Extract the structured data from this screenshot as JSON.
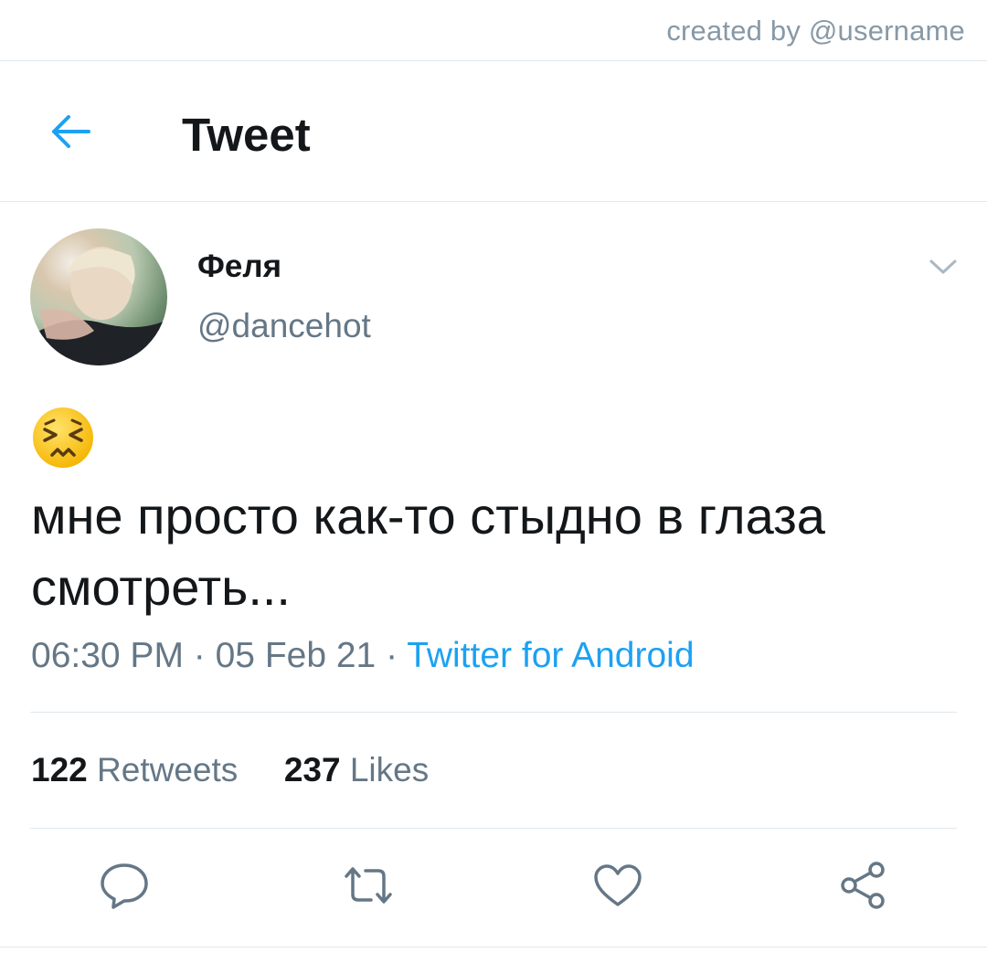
{
  "credit": "created by @username",
  "header": {
    "title": "Tweet"
  },
  "author": {
    "name": "Феля",
    "handle": "@dancehot"
  },
  "tweet": {
    "emoji": "😣",
    "text": "мне просто как-то стыдно в глаза смотреть..."
  },
  "meta": {
    "time": "06:30 PM",
    "separator": " · ",
    "date": "05 Feb 21",
    "source": "Twitter for Android"
  },
  "stats": {
    "retweets_count": "122",
    "retweets_label": "Retweets",
    "likes_count": "237",
    "likes_label": "Likes"
  },
  "icons": {
    "back": "back-arrow-icon",
    "more": "chevron-down-icon",
    "reply": "reply-icon",
    "retweet": "retweet-icon",
    "like": "heart-icon",
    "share": "share-icon"
  },
  "colors": {
    "accent": "#1da1f2",
    "secondary_text": "#657786",
    "icon": "#657786",
    "divider": "#e1e8ed"
  }
}
